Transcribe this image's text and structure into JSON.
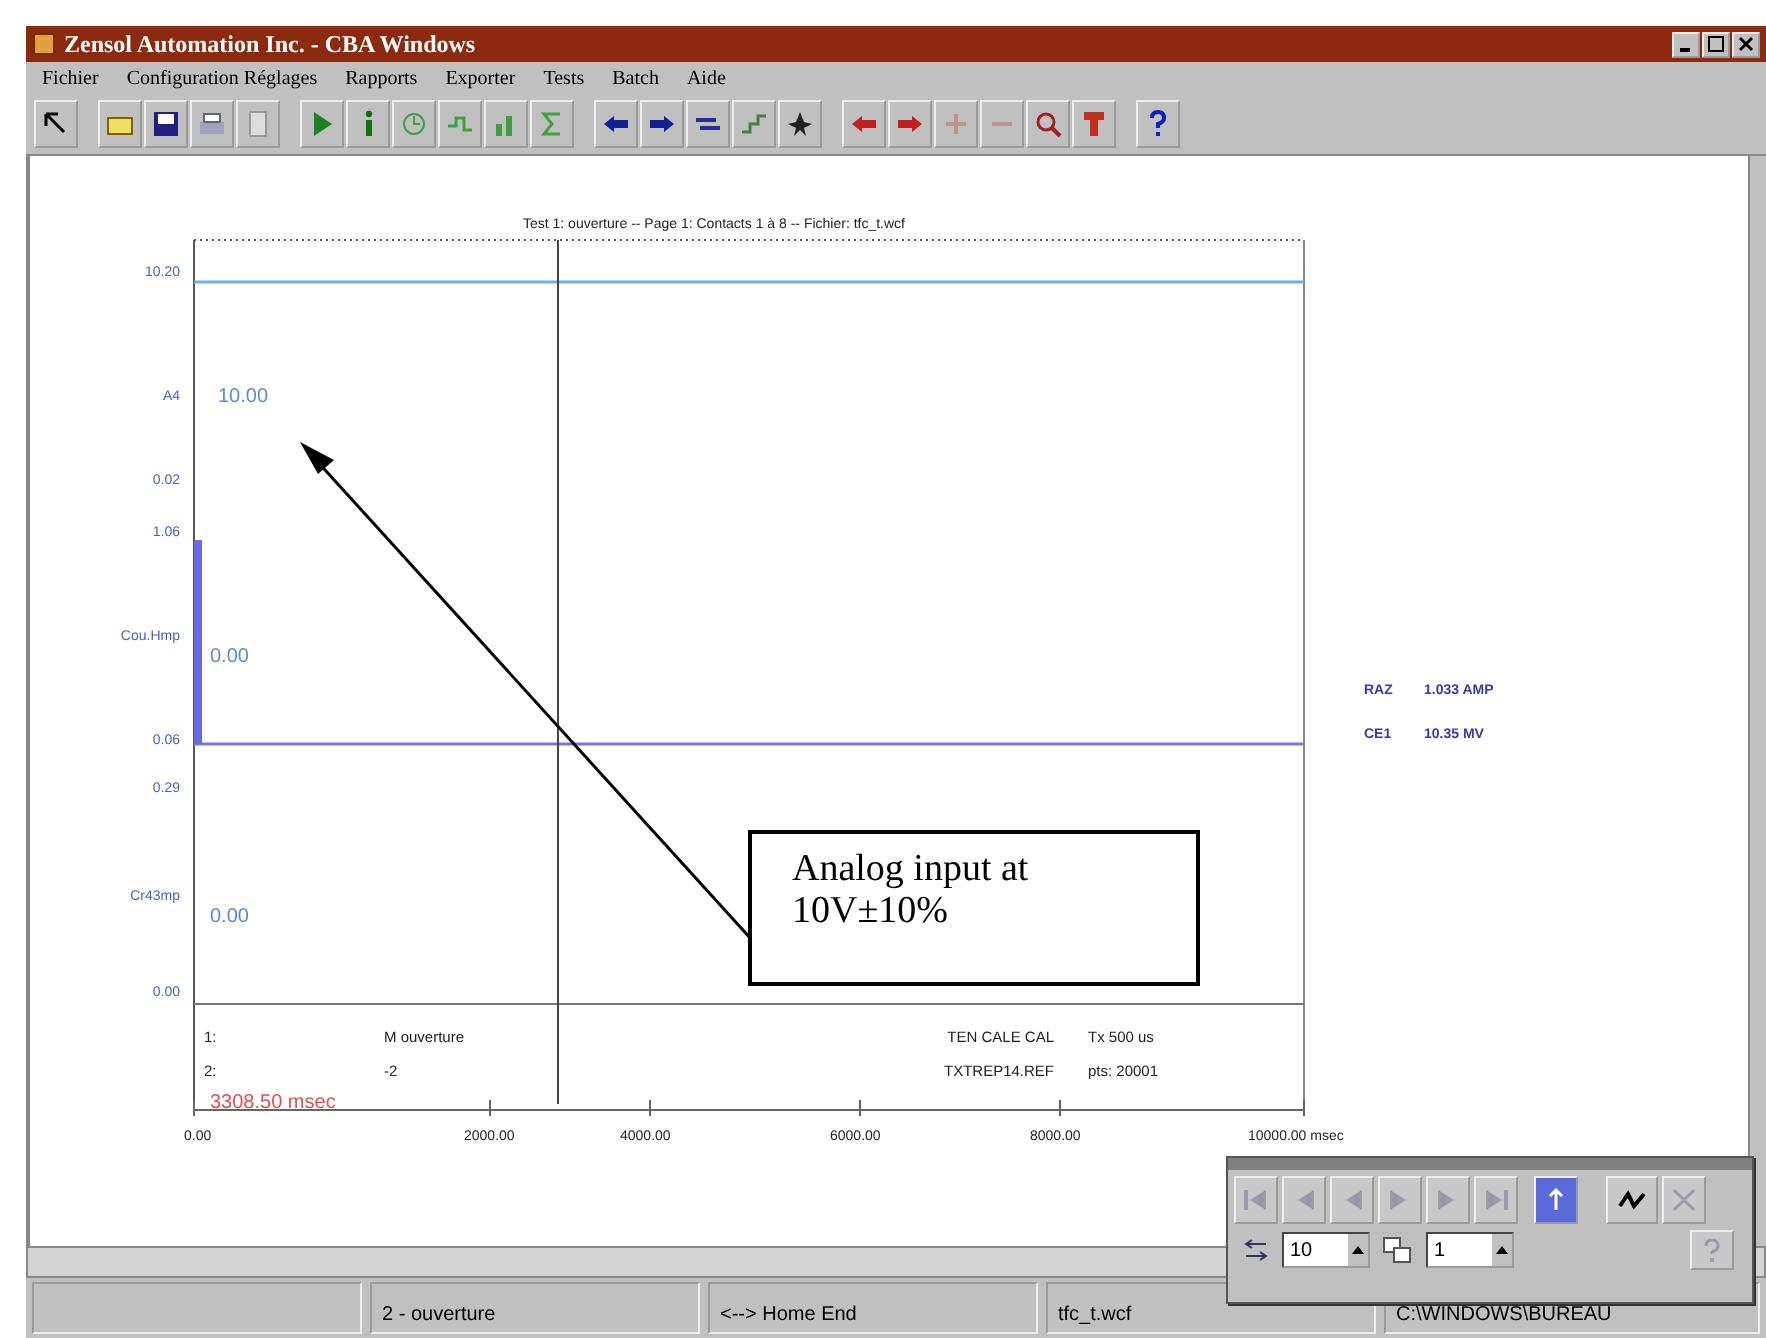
{
  "window": {
    "title": "Zensol Automation Inc. - CBA Windows"
  },
  "menu": [
    "Fichier",
    "Configuration Réglages",
    "Rapports",
    "Exporter",
    "Tests",
    "Batch",
    "Aide"
  ],
  "chart_header": "Test 1: ouverture -- Page 1: Contacts 1 à 8 -- Fichier: tfc_t.wcf",
  "y_labels": [
    "10.20",
    "A4",
    "0.02",
    "1.06",
    "Cou.Hmp",
    "0.06",
    "0.29",
    "Cr43mp",
    "0.00"
  ],
  "trace_values": [
    "10.00",
    "0.00",
    "0.00"
  ],
  "readouts": [
    {
      "label": "RAZ",
      "value": "1.033 AMP"
    },
    {
      "label": "CE1",
      "value": "10.35 MV"
    }
  ],
  "footer_rows": [
    {
      "index": "1:",
      "name": "M ouverture",
      "file": "TEN CALE CAL",
      "info": "Tx 500 us"
    },
    {
      "index": "2:",
      "name": "-2",
      "file": "TXTREP14.REF",
      "info": "pts: 20001"
    }
  ],
  "cursor_reading": "3308.50 msec",
  "x_labels": [
    "0.00",
    "2000.00",
    "4000.00",
    "6000.00",
    "8000.00",
    "10000.00 msec"
  ],
  "annotation": "Analog input at 10V±10%",
  "palette": {
    "step": "10",
    "page": "1"
  },
  "status_bar": [
    "2 - ouverture",
    "<--> Home End",
    "tfc_t.wcf",
    "C:\\WINDOWS\\BUREAU"
  ]
}
